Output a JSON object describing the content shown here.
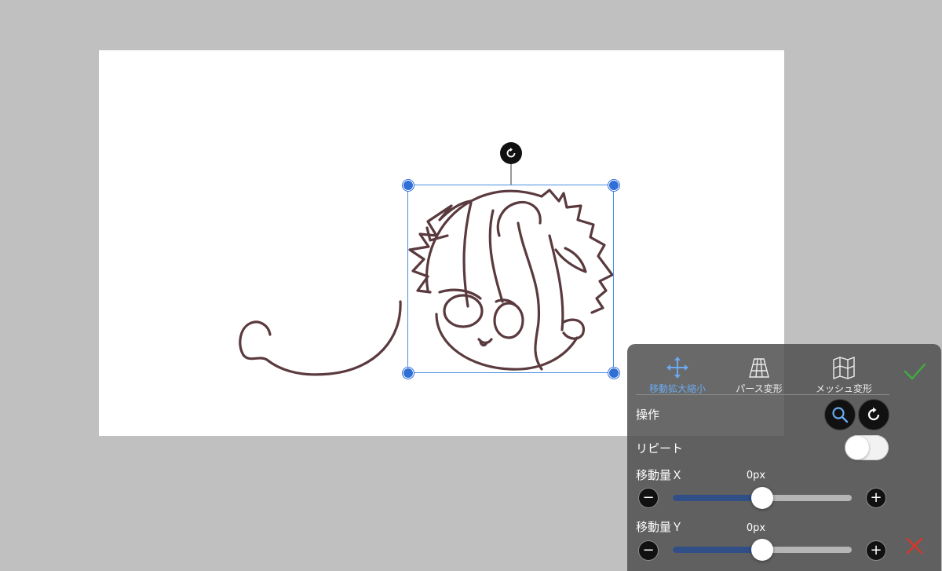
{
  "toolbar": {
    "tabs": [
      {
        "label": "移動拡大縮小",
        "icon": "move-arrows-icon",
        "active": true
      },
      {
        "label": "パース変形",
        "icon": "perspective-grid-icon",
        "active": false
      },
      {
        "label": "メッシュ変形",
        "icon": "mesh-map-icon",
        "active": false
      }
    ],
    "confirm_icon": "checkmark-icon",
    "cancel_icon": "close-x-icon"
  },
  "controls": {
    "operation_label": "操作",
    "repeat_label": "リピート",
    "repeat_on": false,
    "move_x": {
      "label": "移動量Ｘ",
      "value": "0px",
      "level": 0.5
    },
    "move_y": {
      "label": "移動量Ｙ",
      "value": "0px",
      "level": 0.5
    }
  },
  "colors": {
    "accent": "#6aaaf0",
    "confirm": "#3fae3f",
    "cancel": "#d9362b",
    "stroke": "#5a3a3e",
    "selection": "#4a90e2",
    "slider_fill": "#2f4f86"
  }
}
